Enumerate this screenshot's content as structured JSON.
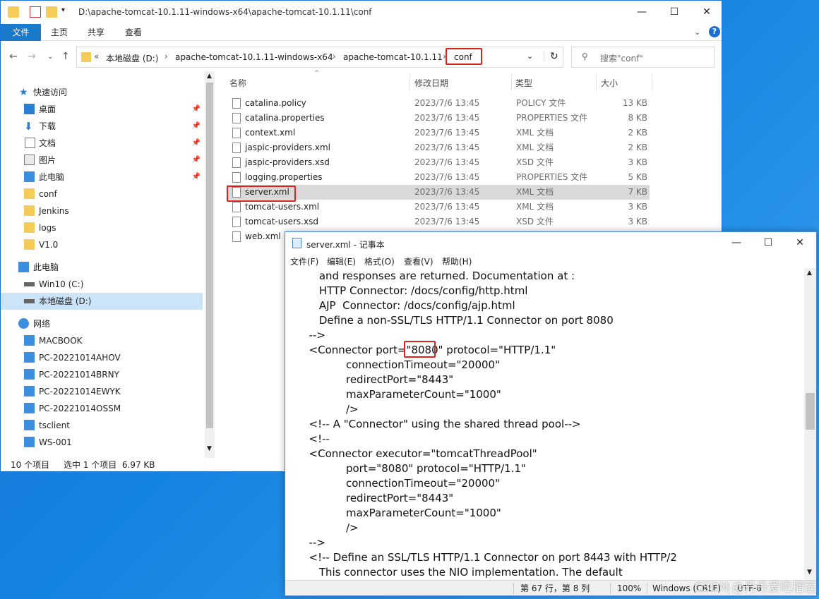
{
  "explorer": {
    "title_path": "D:\\apache-tomcat-10.1.11-windows-x64\\apache-tomcat-10.1.11\\conf",
    "ribbon_tabs": [
      "文件",
      "主页",
      "共享",
      "查看"
    ],
    "breadcrumbs": [
      "本地磁盘 (D:)",
      "apache-tomcat-10.1.11-windows-x64",
      "apache-tomcat-10.1.11",
      "conf"
    ],
    "breadcrumb_prefix": "«",
    "search_placeholder": "搜索\"conf\"",
    "columns": [
      "名称",
      "修改日期",
      "类型",
      "大小"
    ],
    "files": [
      {
        "name": "catalina.policy",
        "date": "2023/7/6 13:45",
        "type": "POLICY 文件",
        "size": "13 KB"
      },
      {
        "name": "catalina.properties",
        "date": "2023/7/6 13:45",
        "type": "PROPERTIES 文件",
        "size": "8 KB"
      },
      {
        "name": "context.xml",
        "date": "2023/7/6 13:45",
        "type": "XML 文档",
        "size": "2 KB"
      },
      {
        "name": "jaspic-providers.xml",
        "date": "2023/7/6 13:45",
        "type": "XML 文档",
        "size": "2 KB"
      },
      {
        "name": "jaspic-providers.xsd",
        "date": "2023/7/6 13:45",
        "type": "XSD 文件",
        "size": "3 KB"
      },
      {
        "name": "logging.properties",
        "date": "2023/7/6 13:45",
        "type": "PROPERTIES 文件",
        "size": "5 KB"
      },
      {
        "name": "server.xml",
        "date": "2023/7/6 13:45",
        "type": "XML 文档",
        "size": "7 KB"
      },
      {
        "name": "tomcat-users.xml",
        "date": "2023/7/6 13:45",
        "type": "XML 文档",
        "size": "3 KB"
      },
      {
        "name": "tomcat-users.xsd",
        "date": "2023/7/6 13:45",
        "type": "XSD 文件",
        "size": "3 KB"
      },
      {
        "name": "web.xml",
        "date": "",
        "type": "",
        "size": ""
      }
    ],
    "nav": {
      "quick_access": "快速访问",
      "quick_items": [
        "桌面",
        "下载",
        "文档",
        "图片",
        "此电脑",
        "conf",
        "Jenkins",
        "logs",
        "V1.0"
      ],
      "this_pc": "此电脑",
      "drives": [
        "Win10 (C:)",
        "本地磁盘 (D:)"
      ],
      "network": "网络",
      "network_items": [
        "MACBOOK",
        "PC-20221014AHOV",
        "PC-20221014BRNY",
        "PC-20221014EWYK",
        "PC-20221014OSSM",
        "tsclient",
        "WS-001"
      ]
    },
    "status": {
      "count": "10 个项目",
      "selection": "选中 1 个项目  6.97 KB"
    }
  },
  "notepad": {
    "title": "server.xml - 记事本",
    "menu": [
      "文件(F)",
      "编辑(E)",
      "格式(O)",
      "查看(V)",
      "帮助(H)"
    ],
    "lines": [
      "     and responses are returned. Documentation at :",
      "     HTTP Connector: /docs/config/http.html",
      "     AJP  Connector: /docs/config/ajp.html",
      "     Define a non-SSL/TLS HTTP/1.1 Connector on port 8080",
      "  -->",
      "  <Connector port=\"8080\" protocol=\"HTTP/1.1\"",
      "             connectionTimeout=\"20000\"",
      "             redirectPort=\"8443\"",
      "             maxParameterCount=\"1000\"",
      "             />",
      "  <!-- A \"Connector\" using the shared thread pool-->",
      "  <!--",
      "  <Connector executor=\"tomcatThreadPool\"",
      "             port=\"8080\" protocol=\"HTTP/1.1\"",
      "             connectionTimeout=\"20000\"",
      "             redirectPort=\"8443\"",
      "             maxParameterCount=\"1000\"",
      "             />",
      "  -->",
      "  <!-- Define an SSL/TLS HTTP/1.1 Connector on port 8443 with HTTP/2",
      "     This connector uses the NIO implementation. The default"
    ],
    "status": {
      "position": "第 67 行，第 8 列",
      "zoom": "100%",
      "encoding": "Windows (CRLF)",
      "charset": "UTF-8"
    }
  },
  "watermark": "CSDN @丹丹爱吃榴莲"
}
